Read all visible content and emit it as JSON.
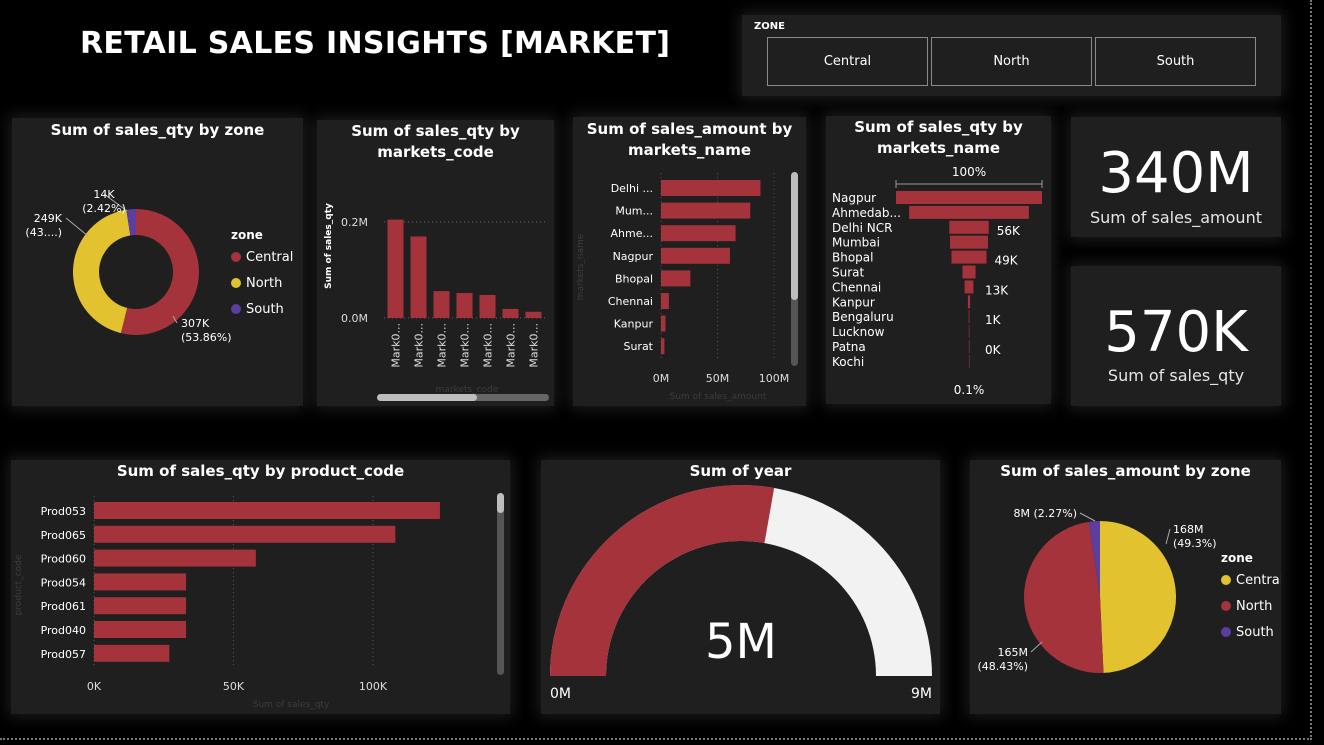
{
  "header": {
    "title": "RETAIL SALES INSIGHTS [MARKET]"
  },
  "slicer": {
    "title": "ZONE",
    "options": [
      "Central",
      "North",
      "South"
    ]
  },
  "colors": {
    "central_sales_qty": "#a4333c",
    "north_sales_qty": "#e3c22f",
    "south": "#5b3ea0",
    "bar": "#a4333c",
    "background": "#000000",
    "card": "#1f1f1f",
    "gauge_track": "#f2f2f2"
  },
  "kpis": [
    {
      "value": "340M",
      "label": "Sum of sales_amount"
    },
    {
      "value": "570K",
      "label": "Sum of sales_qty"
    }
  ],
  "chart_data": [
    {
      "id": "qty-by-zone",
      "type": "pie",
      "title": "Sum of sales_qty by zone",
      "legend_title": "zone",
      "legend_position": "right",
      "categories": [
        "Central",
        "North",
        "South"
      ],
      "values": [
        307,
        249,
        14
      ],
      "unit": "K",
      "labels": [
        "307K (53.86%)",
        "249K (43....)",
        "14K (2.42%)"
      ],
      "percents": [
        53.86,
        43.72,
        2.42
      ],
      "colors": [
        "#a4333c",
        "#e3c22f",
        "#5b3ea0"
      ]
    },
    {
      "id": "qty-by-markets-code",
      "type": "bar",
      "title": "Sum of sales_qty by markets_code",
      "xlabel": "markets_code",
      "ylabel": "Sum of sales_qty",
      "categories": [
        "Mark0...",
        "Mark0...",
        "Mark0...",
        "Mark0...",
        "Mark0...",
        "Mark0...",
        "Mark0..."
      ],
      "values": [
        0.205,
        0.17,
        0.056,
        0.052,
        0.048,
        0.019,
        0.013
      ],
      "y_ticks": [
        "0.0M",
        "0.2M"
      ],
      "ylim": [
        0,
        0.2
      ],
      "unit": "M"
    },
    {
      "id": "amount-by-markets-name",
      "type": "bar",
      "orientation": "horizontal",
      "title": "Sum of sales_amount by markets_name",
      "xlabel": "Sum of sales_amount",
      "ylabel": "markets_name",
      "categories": [
        "Delhi ...",
        "Mum...",
        "Ahme...",
        "Nagpur",
        "Bhopal",
        "Chennai",
        "Kanpur",
        "Surat"
      ],
      "values": [
        88,
        79,
        66,
        61,
        26,
        7,
        4,
        3
      ],
      "x_ticks": [
        "0M",
        "50M",
        "100M"
      ],
      "xlim": [
        0,
        100
      ],
      "unit": "M"
    },
    {
      "id": "qty-by-markets-name-funnel",
      "type": "bar",
      "subtype": "funnel",
      "title": "Sum of sales_qty by markets_name",
      "top_label": "100%",
      "bottom_label": "0.1%",
      "categories": [
        "Nagpur",
        "Ahmedab...",
        "Delhi NCR",
        "Mumbai",
        "Bhopal",
        "Surat",
        "Chennai",
        "Kanpur",
        "Bengaluru",
        "Lucknow",
        "Patna",
        "Kochi"
      ],
      "values": [
        100,
        82,
        27,
        26,
        24,
        9,
        6,
        1.5,
        0.5,
        0.3,
        0.2,
        0.1
      ],
      "value_labels": [
        "",
        "",
        "56K",
        "",
        "49K",
        "",
        "13K",
        "",
        "1K",
        "",
        "0K",
        ""
      ]
    },
    {
      "id": "qty-by-product-code",
      "type": "bar",
      "orientation": "horizontal",
      "title": "Sum of sales_qty by product_code",
      "xlabel": "Sum of sales_qty",
      "ylabel": "product_code",
      "categories": [
        "Prod053",
        "Prod065",
        "Prod060",
        "Prod054",
        "Prod061",
        "Prod040",
        "Prod057"
      ],
      "values": [
        124,
        108,
        58,
        33,
        33,
        33,
        27
      ],
      "x_ticks": [
        "0K",
        "50K",
        "100K"
      ],
      "xlim": [
        0,
        100
      ],
      "unit": "K"
    },
    {
      "id": "sum-of-year",
      "type": "gauge",
      "title": "Sum of year",
      "value": 5,
      "value_label": "5M",
      "min_label": "0M",
      "max_label": "9M",
      "min": 0,
      "max": 9,
      "unit": "M"
    },
    {
      "id": "amount-by-zone",
      "type": "pie",
      "title": "Sum of sales_amount by zone",
      "legend_title": "zone",
      "legend_position": "right",
      "categories": [
        "Central",
        "North",
        "South"
      ],
      "values": [
        168,
        165,
        8
      ],
      "unit": "M",
      "labels": [
        "168M (49.3%)",
        "165M (48.43%)",
        "8M (2.27%)"
      ],
      "percents": [
        49.3,
        48.43,
        2.27
      ],
      "colors": [
        "#e3c22f",
        "#a4333c",
        "#5b3ea0"
      ]
    }
  ]
}
